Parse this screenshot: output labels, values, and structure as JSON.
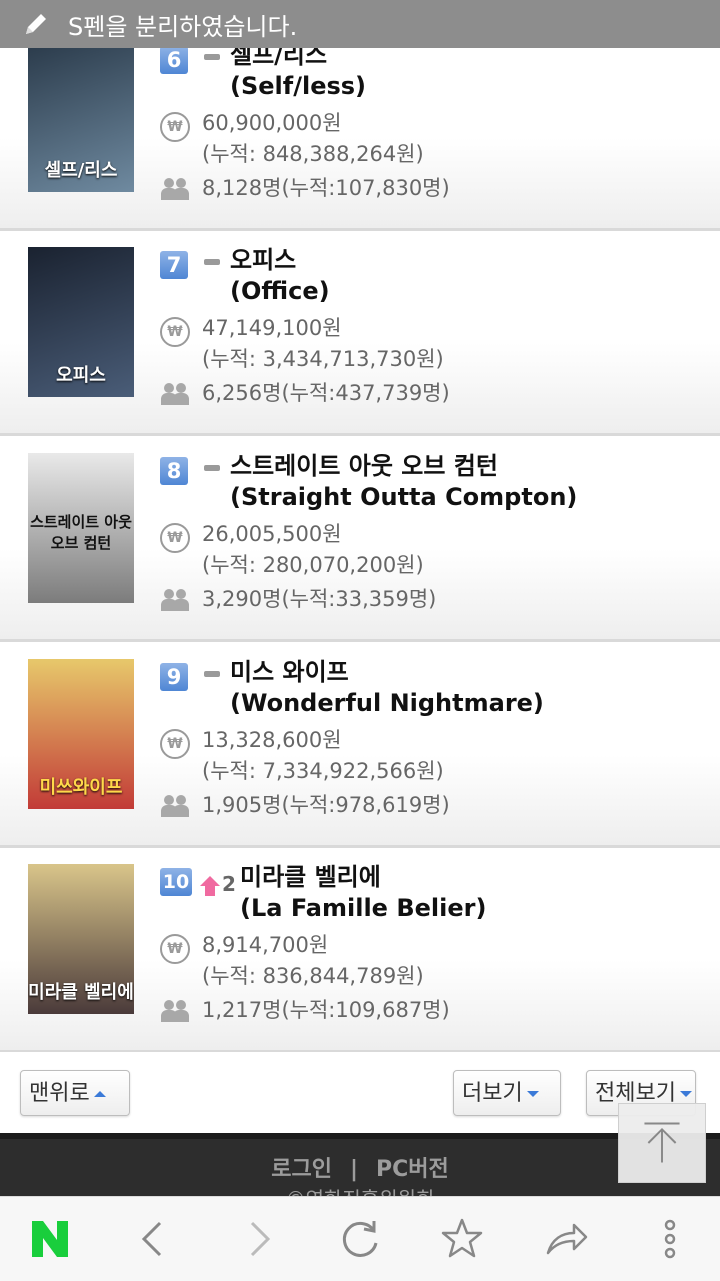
{
  "notification": {
    "text": "S펜을 분리하였습니다.",
    "icon": "pen-icon"
  },
  "movies": [
    {
      "rank": "6",
      "change_type": "same",
      "change_value": "",
      "title_ko": "셀프/리스",
      "title_en": "(Self/less)",
      "sales": "60,900,000원",
      "sales_total": "(누적: 848,388,264원)",
      "audience": "8,128명(누적:107,830명)",
      "poster_title": "셀프/리스",
      "poster_colors": [
        "#2a3a4a",
        "#6f8aa0"
      ]
    },
    {
      "rank": "7",
      "change_type": "same",
      "change_value": "",
      "title_ko": "오피스",
      "title_en": "(Office)",
      "sales": "47,149,100원",
      "sales_total": "(누적: 3,434,713,730원)",
      "audience": "6,256명(누적:437,739명)",
      "poster_title": "오피스",
      "poster_colors": [
        "#1a2230",
        "#4a5d78"
      ]
    },
    {
      "rank": "8",
      "change_type": "same",
      "change_value": "",
      "title_ko": "스트레이트 아웃 오브 컴턴",
      "title_en": "(Straight Outta Compton)",
      "sales": "26,005,500원",
      "sales_total": "(누적: 280,070,200원)",
      "audience": "3,290명(누적:33,359명)",
      "poster_title": "스트레이트 아웃 오브 컴턴",
      "poster_colors": [
        "#e9e9e9",
        "#7c7c7c"
      ]
    },
    {
      "rank": "9",
      "change_type": "same",
      "change_value": "",
      "title_ko": "미스 와이프",
      "title_en": "(Wonderful Nightmare)",
      "sales": "13,328,600원",
      "sales_total": "(누적: 7,334,922,566원)",
      "audience": "1,905명(누적:978,619명)",
      "poster_title": "미쓰와이프",
      "poster_colors": [
        "#e7c86b",
        "#c23b37"
      ]
    },
    {
      "rank": "10",
      "change_type": "up",
      "change_value": "2",
      "title_ko": "미라클 벨리에",
      "title_en": "(La Famille Belier)",
      "sales": "8,914,700원",
      "sales_total": "(누적: 836,844,789원)",
      "audience": "1,217명(누적:109,687명)",
      "poster_title": "미라클 벨리에",
      "poster_colors": [
        "#d9c58a",
        "#4a3a3a"
      ]
    }
  ],
  "buttons": {
    "top": "맨위로",
    "more": "더보기",
    "all": "전체보기"
  },
  "footer": {
    "login": "로그인",
    "separator": "|",
    "pc": "PC버전",
    "copyright": "©영화진흥위원회"
  },
  "nav_icons": [
    "naver-home-icon",
    "back-icon",
    "forward-icon",
    "refresh-icon",
    "bookmark-star-icon",
    "share-icon",
    "more-icon"
  ],
  "colors": {
    "naver_green": "#19ce3c",
    "rank_blue": "#4f86d4",
    "up_pink": "#f06aa0",
    "arrow_blue": "#3b7ad8"
  }
}
